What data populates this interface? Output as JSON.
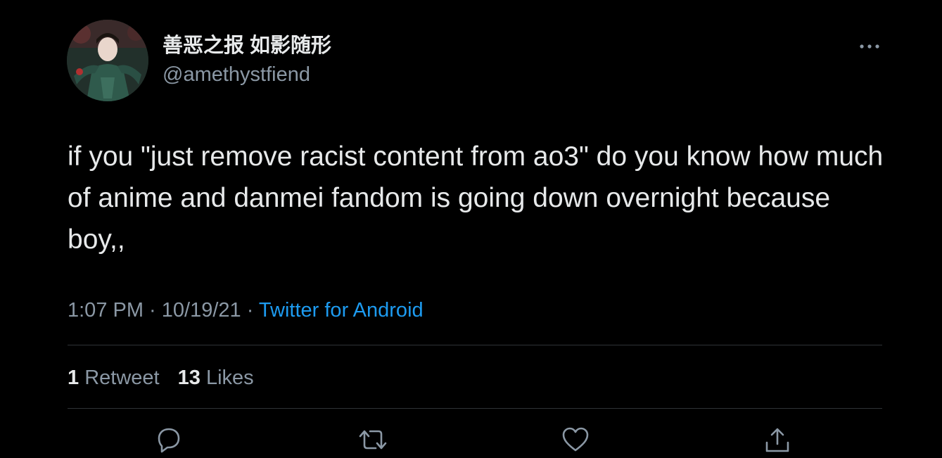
{
  "user": {
    "display_name": "善恶之报 如影随形",
    "handle": "@amethystfiend"
  },
  "tweet": {
    "text": "if you \"just remove racist content from ao3\" do you know how much of anime and danmei fandom is going down overnight because boy,,",
    "time": "1:07 PM",
    "separator": " · ",
    "date": "10/19/21",
    "source": "Twitter for Android"
  },
  "stats": {
    "retweets_count": "1",
    "retweets_label": "Retweet",
    "likes_count": "13",
    "likes_label": "Likes"
  },
  "icons": {
    "more": "more-horizontal-icon",
    "reply": "reply-icon",
    "retweet": "retweet-icon",
    "like": "heart-icon",
    "share": "share-icon"
  },
  "colors": {
    "background": "#000000",
    "text": "#e7e9ea",
    "secondary": "#8b98a5",
    "link": "#1d9bf0",
    "divider": "#2f3336"
  }
}
